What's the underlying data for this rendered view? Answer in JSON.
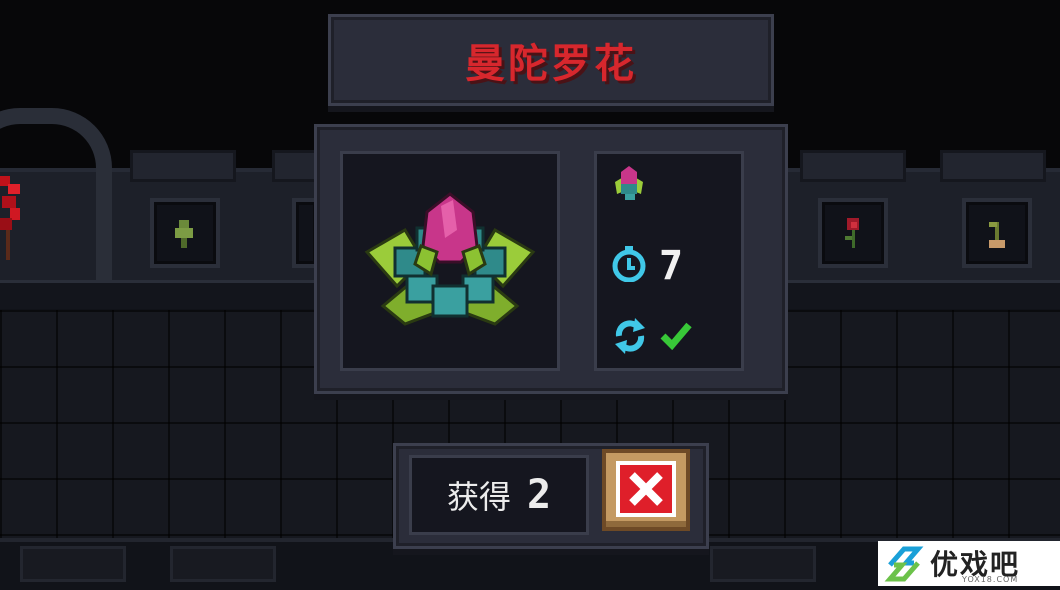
{
  "item": {
    "name": "曼陀罗花",
    "growth_time": "7",
    "repeatable_icon": "cycle-icon",
    "repeatable_state": "check-icon"
  },
  "reward": {
    "label": "获得",
    "count": "2"
  },
  "close_icon": "close-x-icon",
  "watermark": {
    "brand": "优戏吧",
    "domain": "YOX18.COM"
  },
  "colors": {
    "title_red": "#d7272d",
    "panel": "#2b2d3a",
    "slot": "#15161f",
    "close_red": "#df1f2a",
    "close_frame": "#c49a62",
    "timer_cyan": "#40c8e8",
    "check_green": "#38c838"
  }
}
